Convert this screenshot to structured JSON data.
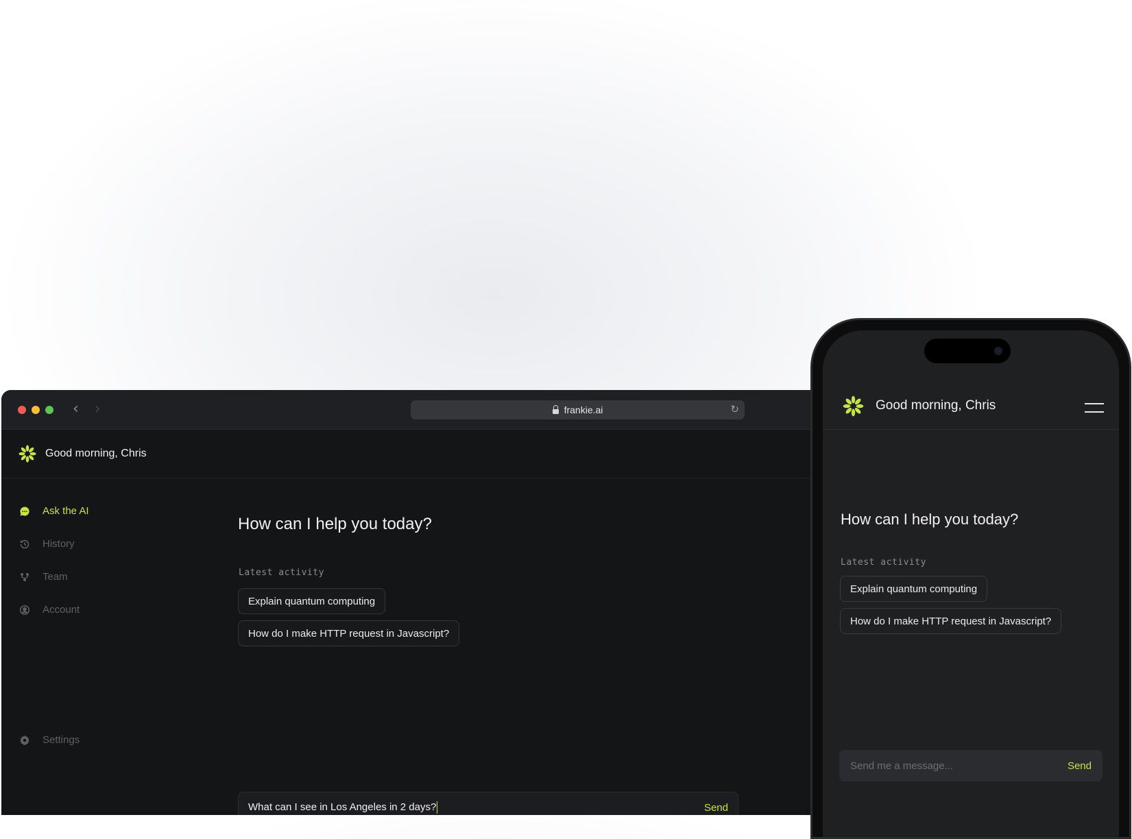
{
  "colors": {
    "accent": "#c5e34a",
    "background": "#141517"
  },
  "browser": {
    "url": "frankie.ai",
    "back_icon": "chevron-left-icon",
    "forward_icon": "chevron-right-icon",
    "reload_icon": "reload-icon"
  },
  "desktop": {
    "greeting": "Good morning, Chris",
    "sidebar": {
      "items": [
        {
          "label": "Ask the AI",
          "icon": "chat-bubble-icon",
          "active": true
        },
        {
          "label": "History",
          "icon": "history-icon",
          "active": false
        },
        {
          "label": "Team",
          "icon": "team-icon",
          "active": false
        },
        {
          "label": "Account",
          "icon": "account-icon",
          "active": false
        }
      ],
      "settings": {
        "label": "Settings",
        "icon": "gear-icon"
      }
    },
    "main": {
      "title": "How can I help you today?",
      "latest_label": "Latest activity",
      "activity": [
        "Explain quantum computing",
        "How do I make HTTP request in Javascript?"
      ],
      "composer": {
        "value": "What can I see in Los Angeles in 2 days?",
        "send_label": "Send"
      }
    }
  },
  "mobile": {
    "greeting": "Good morning, Chris",
    "title": "How can I help you today?",
    "latest_label": "Latest activity",
    "activity": [
      "Explain quantum computing",
      "How do I make HTTP request in Javascript?"
    ],
    "composer": {
      "placeholder": "Send me a message...",
      "send_label": "Send"
    }
  }
}
